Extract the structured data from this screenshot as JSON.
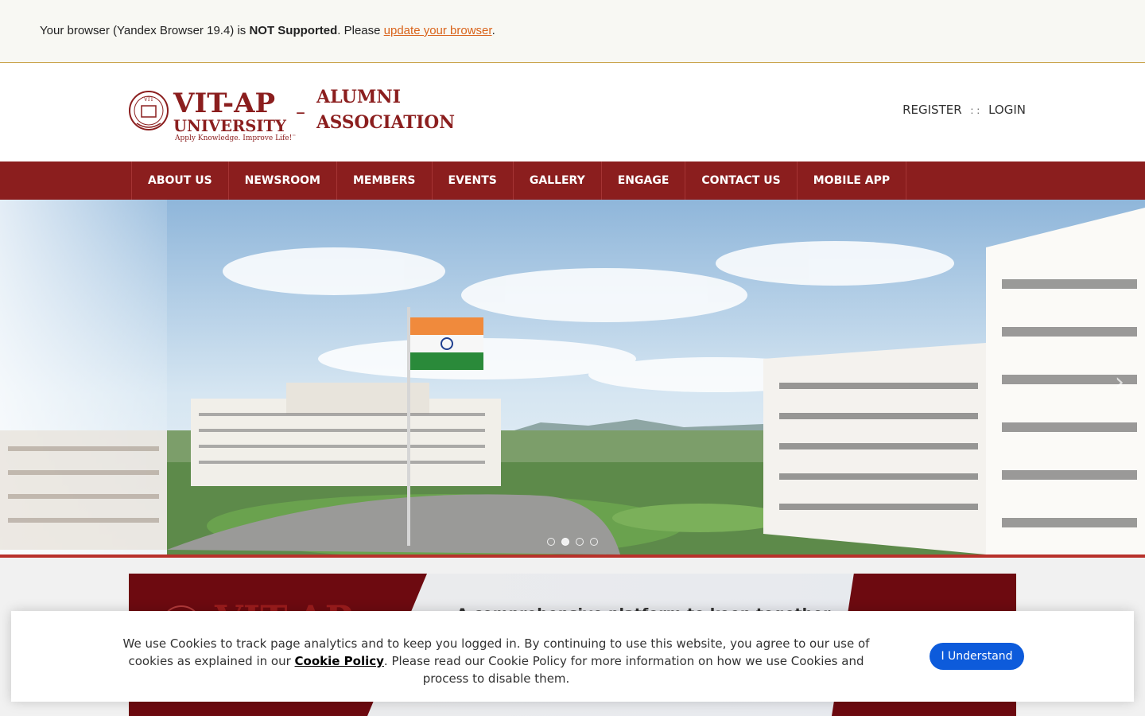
{
  "browser_warning": {
    "prefix": "Your browser (Yandex Browser 19.4) is ",
    "bold": "NOT Supported",
    "middle": ". Please ",
    "link": "update your browser",
    "suffix": "."
  },
  "header": {
    "logo": {
      "brand": "VIT-AP",
      "university": "UNIVERSITY",
      "tagline": "Apply Knowledge. Improve Life!",
      "trademark": "™",
      "seal_text": "VIT",
      "dash": "–",
      "line1": "ALUMNI",
      "line2": "ASSOCIATION"
    },
    "register": "REGISTER",
    "separator": ": :",
    "login": "LOGIN"
  },
  "nav": {
    "items": [
      {
        "label": "ABOUT US"
      },
      {
        "label": "NEWSROOM"
      },
      {
        "label": "MEMBERS"
      },
      {
        "label": "EVENTS"
      },
      {
        "label": "GALLERY"
      },
      {
        "label": "ENGAGE"
      },
      {
        "label": "CONTACT US"
      },
      {
        "label": "MOBILE APP"
      }
    ]
  },
  "slider": {
    "slide_count": 4,
    "active_index": 1,
    "next_icon": "chevron-right-icon"
  },
  "promo": {
    "brand": "VIT-AP",
    "text": "A comprehensive platform to keep together"
  },
  "cookie": {
    "text_before": "We use Cookies to track page analytics and to keep you logged in. By continuing to use this website, you agree to our use of cookies as explained in our ",
    "link": "Cookie Policy",
    "text_after": ". Please read our Cookie Policy for more information on how we use Cookies and process to disable them.",
    "button": "I Understand"
  },
  "colors": {
    "brand_maroon": "#8b1e1e",
    "link_orange": "#d9631a",
    "button_blue": "#0d5bdb"
  }
}
